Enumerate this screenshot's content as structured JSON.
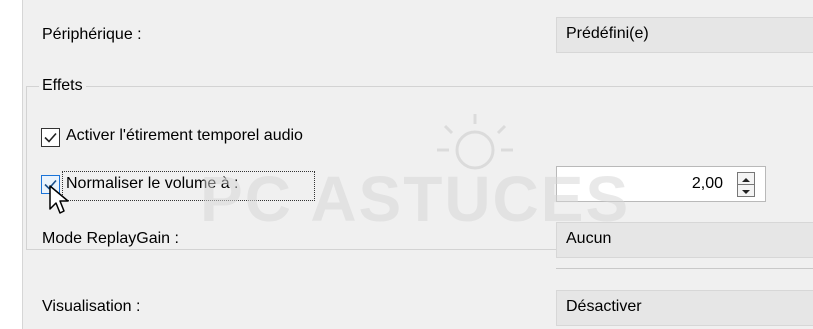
{
  "device": {
    "label": "Périphérique :",
    "value": "Prédéfini(e)"
  },
  "effects": {
    "title": "Effets",
    "timestretch": {
      "label": "Activer l'étirement temporel audio",
      "checked": true
    },
    "normalize": {
      "label": "Normaliser le volume à :",
      "checked": true,
      "value": "2,00"
    },
    "replaygain": {
      "label": "Mode ReplayGain :",
      "value": "Aucun"
    }
  },
  "visualisation": {
    "label": "Visualisation :",
    "value": "Désactiver"
  },
  "watermark": {
    "text": "PC ASTUCES"
  },
  "icons": {
    "checkbox_checked": "checkmark-icon",
    "spin_up": "spin-up-icon",
    "spin_down": "spin-down-icon",
    "cursor": "mouse-cursor-icon"
  }
}
